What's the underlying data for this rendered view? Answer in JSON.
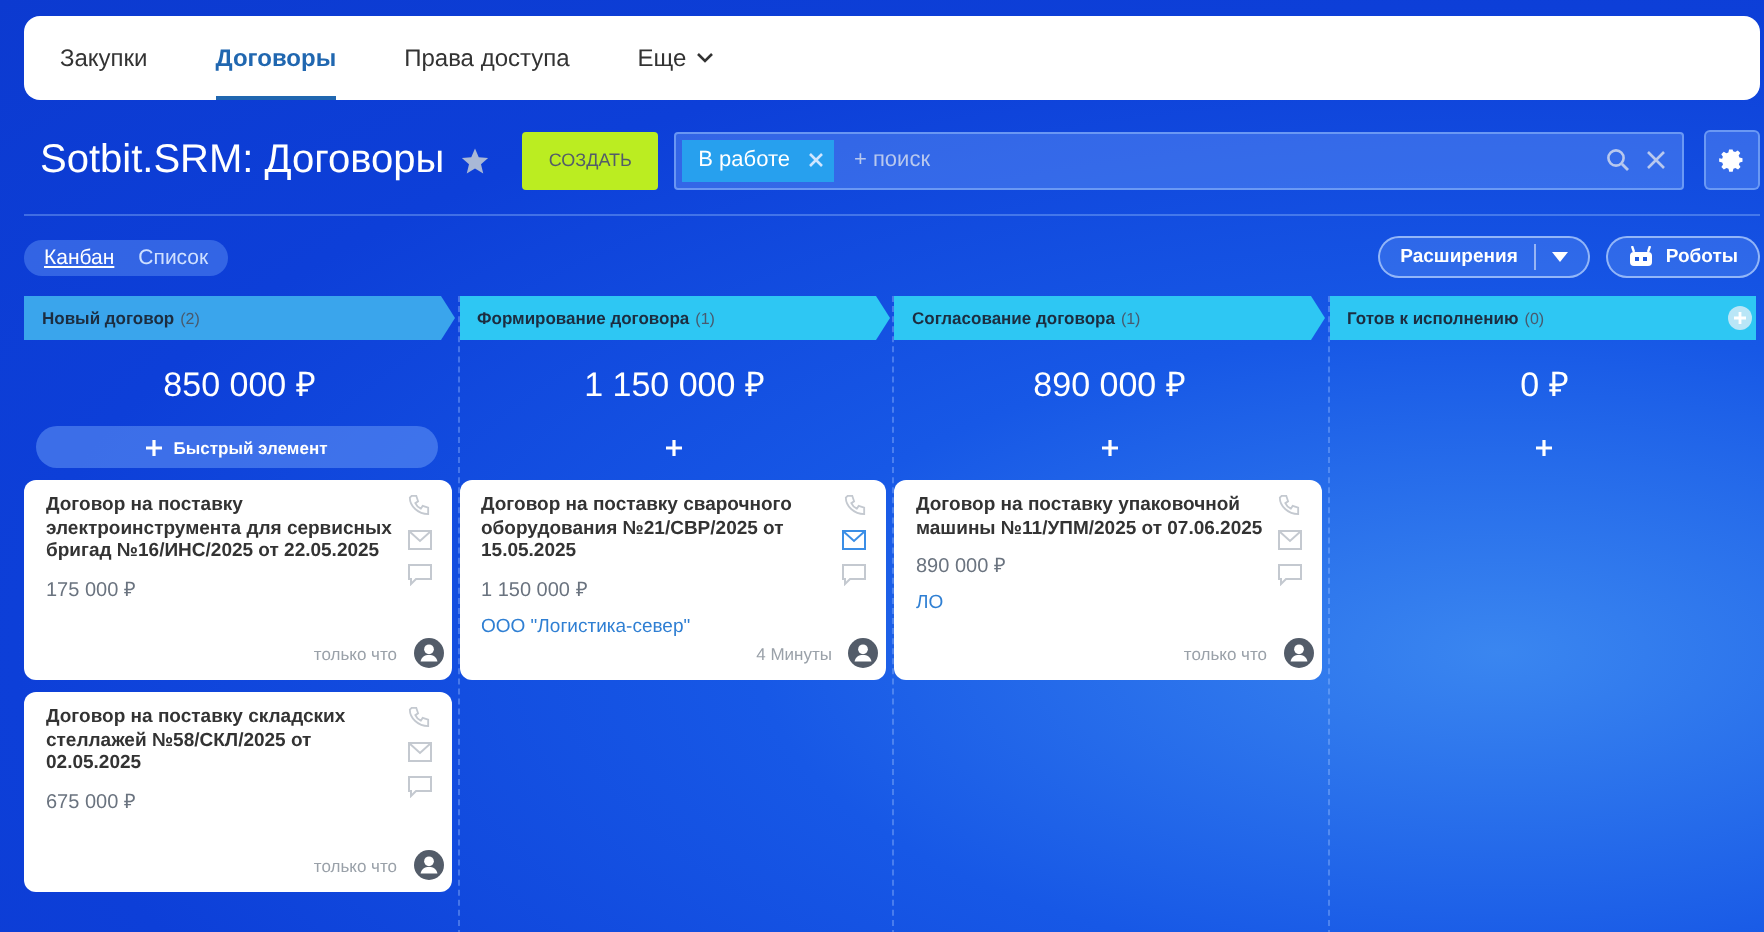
{
  "tabs": [
    {
      "label": "Закупки",
      "selected": false
    },
    {
      "label": "Договоры",
      "selected": true
    },
    {
      "label": "Права доступа",
      "selected": false
    },
    {
      "label": "Еще",
      "selected": false,
      "dropdown": true
    }
  ],
  "title": "Sotbit.SRM: Договоры",
  "create_button": "СОЗДАТЬ",
  "search": {
    "chip": "В работе",
    "placeholder": "+ поиск"
  },
  "views": [
    {
      "label": "Канбан",
      "selected": true
    },
    {
      "label": "Список",
      "selected": false
    }
  ],
  "extensions_button": "Расширения",
  "robots_button": "Роботы",
  "columns": [
    {
      "name": "Новый договор",
      "count": "(2)",
      "color": "#3aa5ec",
      "total": "850 000 ₽",
      "add_label": "Быстрый элемент",
      "cards": [
        {
          "title": "Договор на поставку электроинструмента для сервисных бригад №16/ИНС/2025 от 22.05.2025",
          "amount": "175 000 ₽",
          "time": "только что",
          "mail_active": false
        },
        {
          "title": "Договор на поставку складских стеллажей №58/СКЛ/2025 от 02.05.2025",
          "amount": "675 000 ₽",
          "time": "только что",
          "mail_active": false
        }
      ]
    },
    {
      "name": "Формирование договора",
      "count": "(1)",
      "color": "#2ec7f3",
      "total": "1 150 000 ₽",
      "cards": [
        {
          "title": "Договор на поставку сварочного оборудования №21/СВР/2025 от 15.05.2025",
          "amount": "1 150 000 ₽",
          "company": "ООО \"Логистика-север\"",
          "time": "4 Минуты",
          "mail_active": true
        }
      ]
    },
    {
      "name": "Согласование договора",
      "count": "(1)",
      "color": "#2ec7f3",
      "total": "890 000 ₽",
      "cards": [
        {
          "title": "Договор на поставку упаковочной машины №11/УПМ/2025 от 07.06.2025",
          "amount": "890 000 ₽",
          "company": "ЛО",
          "time": "только что",
          "mail_active": false
        }
      ]
    },
    {
      "name": "Готов к исполнению",
      "count": "(0)",
      "color": "#2ec7f3",
      "total": "0 ₽",
      "last": true
    }
  ]
}
